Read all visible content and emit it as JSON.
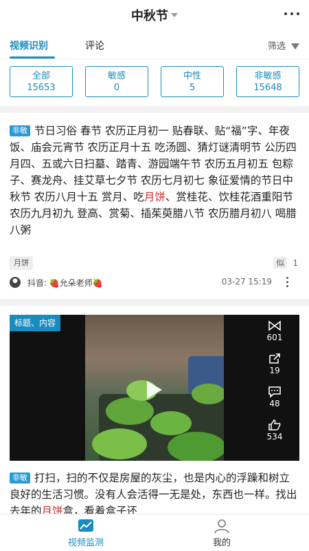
{
  "header": {
    "title": "中秋节",
    "title_dropdown_icon": "caret-down-icon",
    "menu_icon": "more-horizontal-icon"
  },
  "tabs": [
    {
      "label": "视频识别",
      "active": true
    },
    {
      "label": "评论",
      "active": false
    }
  ],
  "filter": {
    "label": "筛选",
    "icon": "filter-icon"
  },
  "stats": [
    {
      "label": "全部",
      "value": "15653"
    },
    {
      "label": "敏感",
      "value": "0"
    },
    {
      "label": "中性",
      "value": "5"
    },
    {
      "label": "非敏感",
      "value": "15648"
    }
  ],
  "cards": [
    {
      "tag": "非敏",
      "text_before": "节日习俗 春节 农历正月初一 贴春联、贴“福”字、年夜饭、庙会元宵节 农历正月十五 吃汤圆、猜灯谜清明节 公历四月四、五或六日扫墓、踏青、游园端午节 农历五月初五 包粽子、赛龙舟、挂艾草七夕节 农历七月初七 象征爱情的节日中秋节 农历八月十五 赏月、吃",
      "highlight": "月饼",
      "text_after": "、赏桂花、饮桂花酒重阳节 农历九月初九 登高、赏菊、插茱萸腊八节 农历腊月初八 喝腊八粥",
      "keyword": "月饼",
      "similar_label": "似",
      "similar_count": "1",
      "source": "抖音: 🍓允朵老师🍓",
      "time": "03-27 15:19"
    },
    {
      "video_badge": "标题、内容",
      "video_stats": [
        {
          "icon": "share-bowtie-icon",
          "value": "601"
        },
        {
          "icon": "forward-icon",
          "value": "19"
        },
        {
          "icon": "comment-icon",
          "value": "48"
        },
        {
          "icon": "thumbs-up-icon",
          "value": "534"
        }
      ],
      "tag": "非敏",
      "text_before": "打扫，扫的不仅是房屋的灰尘，也是内心的浮躁和树立良好的生活习惯。没有人会活得一无是处，东西也一样。找出去年的",
      "highlight": "月饼",
      "text_after": "盒，看着盒子还"
    }
  ],
  "bottom_nav": [
    {
      "label": "视频监测",
      "icon": "chart-line-icon",
      "active": true
    },
    {
      "label": "我的",
      "icon": "user-icon",
      "active": false
    }
  ],
  "colors": {
    "accent": "#1a8bbf",
    "highlight": "#d32f2f",
    "tag": "#2a9ad4"
  }
}
